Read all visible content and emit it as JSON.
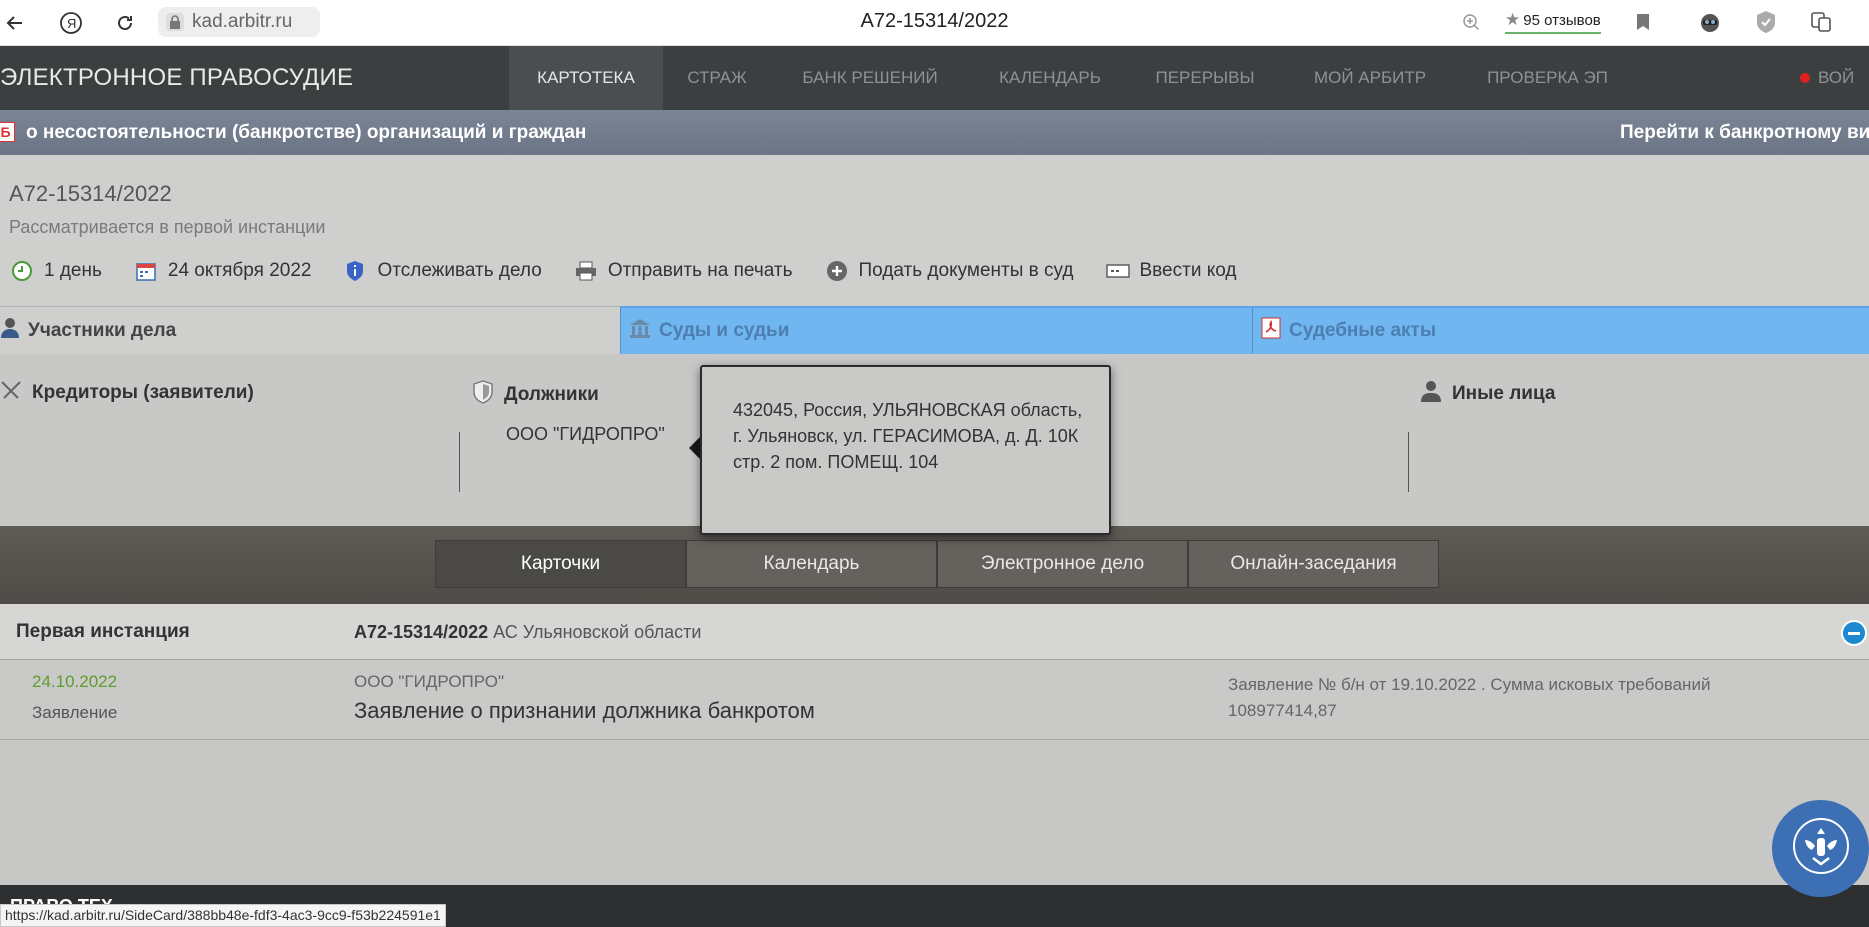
{
  "browser": {
    "url": "kad.arbitr.ru",
    "tab_title": "А72-15314/2022",
    "reviews": "95 отзывов",
    "status_url": "https://kad.arbitr.ru/SideCard/388bb48e-fdf3-4ac3-9cc9-f53b224591e1"
  },
  "site": {
    "logo": "ЭЛЕКТРОННОЕ ПРАВОСУДИЕ",
    "nav": [
      "КАРТОТЕКА",
      "СТРАЖ",
      "БАНК РЕШЕНИЙ",
      "КАЛЕНДАРЬ",
      "ПЕРЕРЫВЫ",
      "МОЙ АРБИТР",
      "ПРОВЕРКА ЭП"
    ],
    "nav_user": "ВОЙ"
  },
  "banner": {
    "letter": "Б",
    "text": "о несостоятельности (банкротстве) организаций и граждан",
    "link": "Перейти к банкротному ви"
  },
  "case": {
    "number": "А72-15314/2022",
    "status": "Рассматривается в первой инстанции",
    "actions": {
      "days": "1 день",
      "date": "24 октября 2022",
      "track": "Отслеживать дело",
      "print": "Отправить на печать",
      "submit": "Подать документы в суд",
      "code": "Ввести код"
    }
  },
  "tabs": {
    "participants": "Участники дела",
    "courts": "Суды и судьи",
    "acts": "Судебные акты"
  },
  "participants": {
    "creditors": "Кредиторы (заявители)",
    "debtors": "Должники",
    "others": "Иные лица",
    "debtor_name": "ООО \"ГИДРОПРО\""
  },
  "popup": {
    "address": "432045, Россия, УЛЬЯНОВСКАЯ область, г. Ульяновск, ул. ГЕРАСИМОВА, д. Д. 10К стр. 2 пом. ПОМЕЩ. 104"
  },
  "sections": [
    "Карточки",
    "Календарь",
    "Электронное дело",
    "Онлайн-заседания"
  ],
  "instance": {
    "label": "Первая инстанция",
    "case_number": "А72-15314/2022",
    "court": "АС Ульяновской области"
  },
  "document": {
    "date": "24.10.2022",
    "type": "Заявление",
    "org": "ООО \"ГИДРОПРО\"",
    "title": "Заявление о признании должника банкротом",
    "description": "Заявление № б/н от 19.10.2022 . Сумма исковых требований 108977414,87"
  },
  "footer": {
    "text": "ПРАВО.ТЕХ"
  },
  "colors": {
    "nav_bg": "#3b3f40",
    "banner_bg": "#6b7585",
    "tab_blue": "#70b6f0",
    "date_green": "#5b9e2e",
    "emblem_blue": "#3d6fb4"
  }
}
